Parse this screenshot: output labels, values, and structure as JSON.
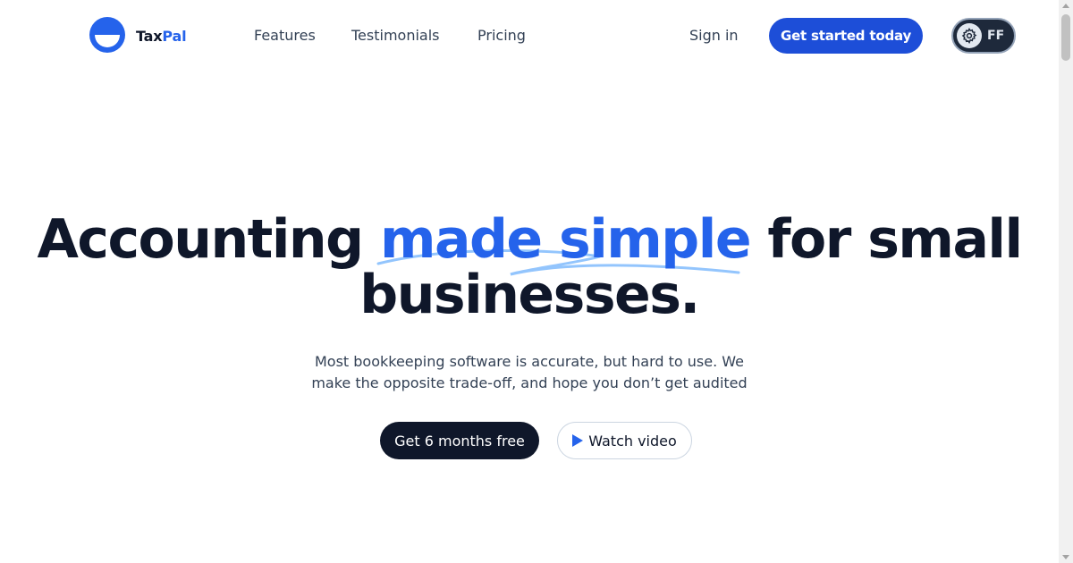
{
  "brand": {
    "name_part1": "Tax",
    "name_part2": "Pal",
    "accent_color": "#2563eb"
  },
  "nav": {
    "items": [
      {
        "label": "Features"
      },
      {
        "label": "Testimonials"
      },
      {
        "label": "Pricing"
      }
    ]
  },
  "header": {
    "signin_label": "Sign in",
    "cta_label": "Get started today"
  },
  "extension": {
    "initials": "FF",
    "icon": "gear-icon"
  },
  "hero": {
    "title_before": "Accounting",
    "title_highlight": "made simple",
    "title_after": "for small businesses.",
    "subtitle": "Most bookkeeping software is accurate, but hard to use. We make the opposite trade-off, and hope you don’t get audited",
    "primary_button": "Get 6 months free",
    "secondary_button": "Watch video",
    "secondary_icon": "play-icon"
  },
  "colors": {
    "primary": "#1d4ed8",
    "dark": "#0f172a",
    "highlight": "#2563eb"
  }
}
